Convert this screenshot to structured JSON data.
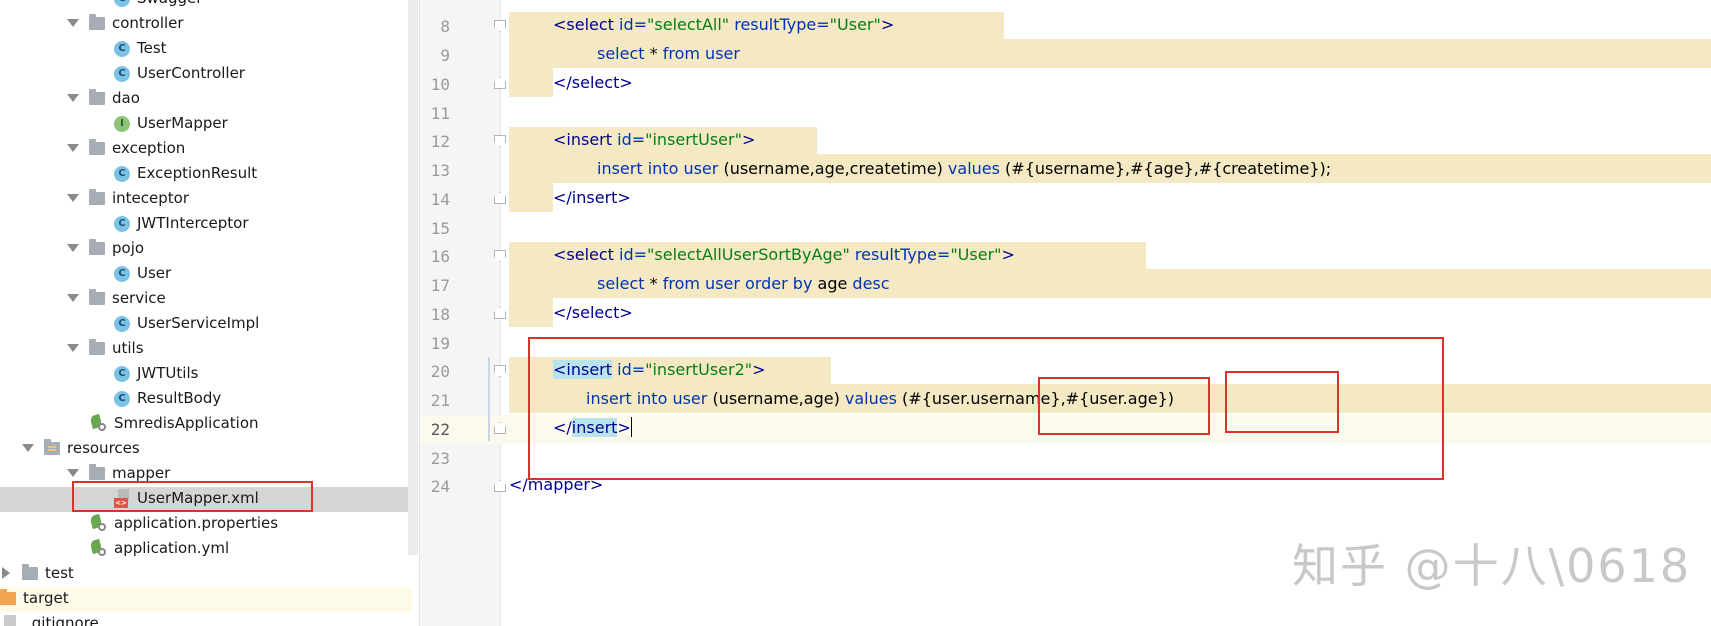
{
  "tree": {
    "items": [
      {
        "label": "Swagger",
        "icon": "class-icon",
        "level": 3
      },
      {
        "label": "controller",
        "icon": "package-folder-icon",
        "level": 2
      },
      {
        "label": "Test",
        "icon": "class-icon",
        "level": 3
      },
      {
        "label": "UserController",
        "icon": "class-icon",
        "level": 3
      },
      {
        "label": "dao",
        "icon": "package-folder-icon",
        "level": 2
      },
      {
        "label": "UserMapper",
        "icon": "interface-icon",
        "level": 3
      },
      {
        "label": "exception",
        "icon": "package-folder-icon",
        "level": 2
      },
      {
        "label": "ExceptionResult",
        "icon": "class-icon",
        "level": 3
      },
      {
        "label": "inteceptor",
        "icon": "package-folder-icon",
        "level": 2
      },
      {
        "label": "JWTInterceptor",
        "icon": "class-icon",
        "level": 3
      },
      {
        "label": "pojo",
        "icon": "package-folder-icon",
        "level": 2
      },
      {
        "label": "User",
        "icon": "class-icon",
        "level": 3
      },
      {
        "label": "service",
        "icon": "package-folder-icon",
        "level": 2
      },
      {
        "label": "UserServiceImpl",
        "icon": "class-icon",
        "level": 3
      },
      {
        "label": "utils",
        "icon": "package-folder-icon",
        "level": 2
      },
      {
        "label": "JWTUtils",
        "icon": "class-icon",
        "level": 3
      },
      {
        "label": "ResultBody",
        "icon": "class-icon",
        "level": 3
      },
      {
        "label": "SmredisApplication",
        "icon": "spring-boot-class-icon",
        "level": 2
      },
      {
        "label": "resources",
        "icon": "resources-folder-icon",
        "level": 1
      },
      {
        "label": "mapper",
        "icon": "folder-icon",
        "level": 2
      },
      {
        "label": "UserMapper.xml",
        "icon": "xml-file-icon",
        "level": 3
      },
      {
        "label": "application.properties",
        "icon": "spring-config-icon",
        "level": 2
      },
      {
        "label": "application.yml",
        "icon": "spring-config-icon",
        "level": 2
      },
      {
        "label": "test",
        "icon": "folder-icon",
        "level": 0
      },
      {
        "label": "target",
        "icon": "excluded-folder-icon",
        "level": 0
      },
      {
        "label": ".gitignore",
        "icon": "file-icon",
        "level": 0
      }
    ],
    "selected": "UserMapper.xml",
    "class_badge": "C",
    "interface_badge": "I",
    "xml_badge": "<>"
  },
  "editor": {
    "line_numbers": [
      "8",
      "9",
      "10",
      "11",
      "12",
      "13",
      "14",
      "15",
      "16",
      "17",
      "18",
      "19",
      "20",
      "21",
      "22",
      "23",
      "24"
    ],
    "current_line": "22",
    "lines": {
      "l8": {
        "a": "<select",
        "b": " id=",
        "c": "\"selectAll\"",
        "d": " resultType=",
        "e": "\"User\"",
        "f": ">"
      },
      "l9": {
        "a": "select",
        "b": " * ",
        "c": "from",
        "d": " ",
        "e": "user"
      },
      "l10": {
        "a": "</select>"
      },
      "l12": {
        "a": "<insert",
        "b": " id=",
        "c": "\"insertUser\"",
        "d": ">"
      },
      "l13": {
        "a": "insert into",
        "b": " ",
        "c": "user",
        "d": " (username,age,createtime) ",
        "e": "values",
        "f": " (#{username},#{age},#{createtime});"
      },
      "l14": {
        "a": "</insert>"
      },
      "l16": {
        "a": "<select",
        "b": " id=",
        "c": "\"selectAllUserSortByAge\"",
        "d": " resultType=",
        "e": "\"User\"",
        "f": ">"
      },
      "l17": {
        "a": "select",
        "b": " * ",
        "c": "from",
        "d": " ",
        "e": "user",
        "f": " ",
        "g": "order by",
        "h": " age ",
        "i": "desc"
      },
      "l18": {
        "a": "</select>"
      },
      "l20": {
        "a": "<",
        "b": "insert",
        "c": " id=",
        "d": "\"insertUser2\"",
        "e": ">"
      },
      "l21": {
        "a": "insert into",
        "b": " ",
        "c": "user",
        "d": " (username,age) ",
        "e": "values",
        "f": " (#",
        "g": "{user.username}",
        "h": ",#",
        "i": "{user.age}",
        "j": ")"
      },
      "l22": {
        "a": "</",
        "b": "insert",
        "c": ">"
      },
      "l24": {
        "a": "</",
        "b": "mapper",
        "c": ">"
      }
    }
  },
  "colors": {
    "highlight_band": "#f5e9c4",
    "annotation_red": "#d9342b",
    "tag": "#00008f",
    "string": "#067d17"
  },
  "watermark": "知乎 @十八\\0618"
}
